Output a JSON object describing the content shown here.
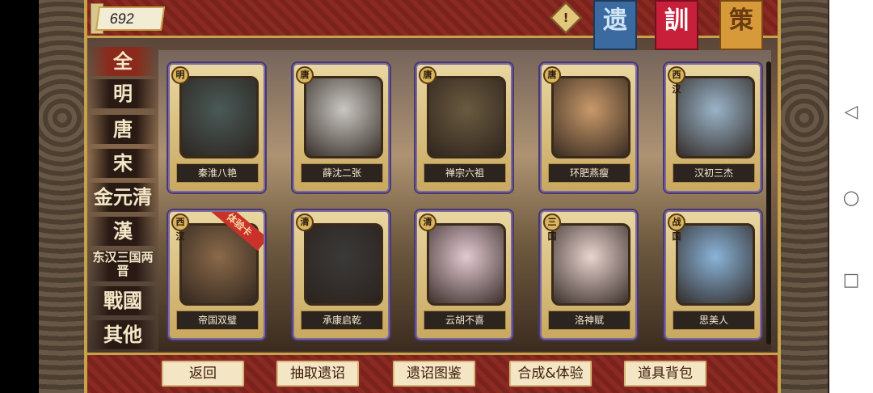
{
  "top": {
    "coins": "692",
    "alert_icon": "!",
    "banners": [
      "遗",
      "訓",
      "策"
    ]
  },
  "categories": [
    "全",
    "明",
    "唐",
    "宋",
    "金元清",
    "漢",
    "东汉三国两晋",
    "戰國",
    "其他"
  ],
  "cards": [
    {
      "era": "明",
      "name": "秦淮八艳",
      "tone": "#4a5a58"
    },
    {
      "era": "唐",
      "name": "薛沈二张",
      "tone": "#c9c7c2"
    },
    {
      "era": "唐",
      "name": "禅宗六祖",
      "tone": "#6a5a40"
    },
    {
      "era": "唐",
      "name": "环肥燕瘦",
      "tone": "#c99a6a"
    },
    {
      "era": "西汉",
      "name": "汉初三杰",
      "tone": "#9ab4c9"
    },
    {
      "era": "西汉",
      "name": "帝国双璧",
      "tone": "#8a6a4a",
      "ribbon": "体验卡"
    },
    {
      "era": "清",
      "name": "承康启乾",
      "tone": "#3a3a3a"
    },
    {
      "era": "清",
      "name": "云胡不喜",
      "tone": "#e4c9d3"
    },
    {
      "era": "三国",
      "name": "洛神赋",
      "tone": "#e9d4d0"
    },
    {
      "era": "战国",
      "name": "思美人",
      "tone": "#8ab4d9"
    }
  ],
  "buttons": [
    "返回",
    "抽取遗诏",
    "遗诏图鉴",
    "合成&体验",
    "道具背包"
  ],
  "nav": {
    "back": "◁",
    "home": "○",
    "recent": "□"
  }
}
